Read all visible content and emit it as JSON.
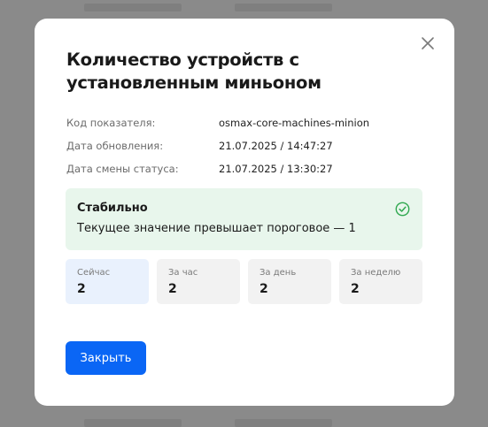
{
  "modal": {
    "title": "Количество устройств с установленным миньоном",
    "meta": [
      {
        "label": "Код показателя:",
        "value": "osmax-core-machines-minion"
      },
      {
        "label": "Дата обновления:",
        "value": "21.07.2025 / 14:47:27"
      },
      {
        "label": "Дата смены статуса:",
        "value": "21.07.2025 / 13:30:27"
      }
    ],
    "status": {
      "title": "Стабильно",
      "text": "Текущее значение превышает пороговое — 1",
      "icon": "check-circle-icon",
      "color": "#2fa84f"
    },
    "stats": [
      {
        "label": "Сейчас",
        "value": "2"
      },
      {
        "label": "За час",
        "value": "2"
      },
      {
        "label": "За день",
        "value": "2"
      },
      {
        "label": "За неделю",
        "value": "2"
      }
    ],
    "close_button_label": "Закрыть",
    "close_icon": "close-icon",
    "accent_color": "#0a66f5"
  }
}
